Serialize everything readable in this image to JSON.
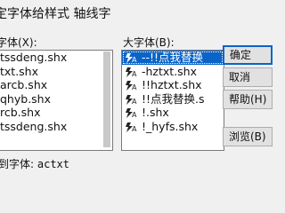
{
  "window": {
    "title": "定字体给样式 轴线字"
  },
  "small_font": {
    "label": "字体(X):",
    "items": [
      "tssdeng.shx",
      "txt.shx",
      "arcb.shx",
      "qhyb.shx",
      "rcb.shx",
      "tssdeng.shx"
    ]
  },
  "big_font": {
    "label": "大字体(B):",
    "items": [
      "--!!点我替换",
      "-hztxt.shx",
      "!!hztxt.shx",
      "!!点我替换.s",
      "!.shx",
      "!_hyfs.shx"
    ],
    "selected_index": 0,
    "item_icon": "font-file-icon"
  },
  "buttons": {
    "ok": "确定",
    "cancel": "取消",
    "help": "帮助(H)",
    "browse": "浏览(B)"
  },
  "match": {
    "label": "到字体:",
    "value": "actxt"
  },
  "colors": {
    "selection": "#0a64c8",
    "window_bg": "#f0f0f0"
  }
}
